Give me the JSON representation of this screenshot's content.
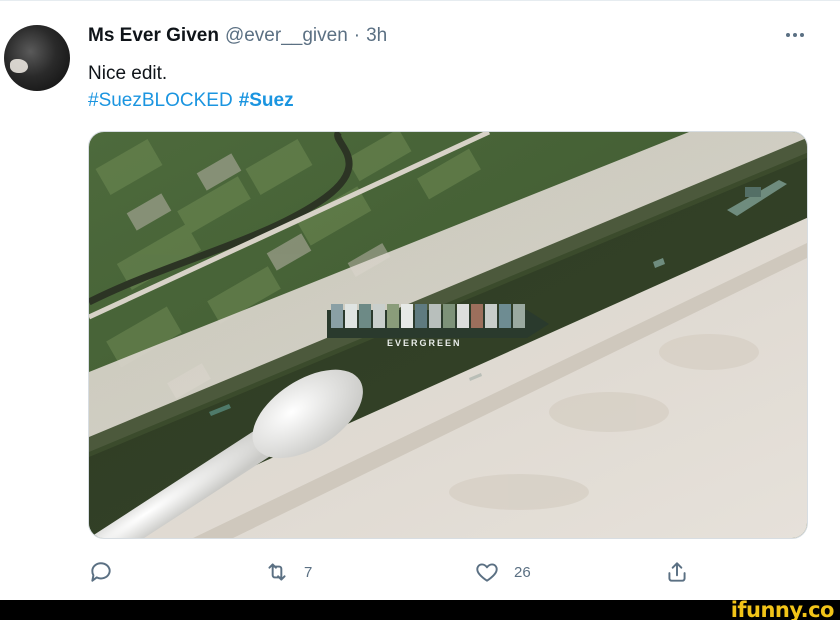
{
  "tweet": {
    "display_name": "Ms Ever Given",
    "handle": "@ever__given",
    "separator": "·",
    "time": "3h",
    "text": "Nice edit.",
    "hashtags": [
      "#SuezBLOCKED",
      "#Suez"
    ],
    "more_icon": "more-horizontal-icon",
    "media": {
      "ship_label": "EVERGREEN",
      "description_icon": "satellite-photo"
    },
    "actions": {
      "reply_icon": "reply-icon",
      "retweet_icon": "retweet-icon",
      "retweet_count": "7",
      "like_icon": "heart-icon",
      "like_count": "26",
      "share_icon": "share-icon"
    }
  },
  "watermark": "ifunny.co",
  "colors": {
    "link": "#1b95e0",
    "muted": "#5b7083",
    "watermark": "#f2c418"
  }
}
